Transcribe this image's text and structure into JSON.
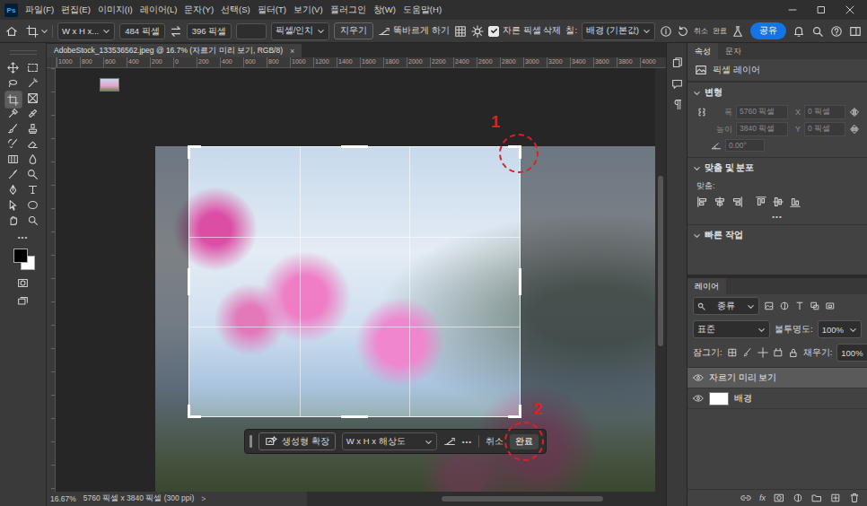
{
  "app": {
    "logo": "Ps"
  },
  "menu": [
    "파일(F)",
    "편집(E)",
    "이미지(I)",
    "레이어(L)",
    "문자(Y)",
    "선택(S)",
    "필터(T)",
    "보기(V)",
    "플러그인",
    "창(W)",
    "도움말(H)"
  ],
  "options_bar": {
    "preset": "W x H x...",
    "width": "484 픽셀",
    "height": "396 픽셀",
    "resolution": "",
    "unit": "픽셀/인치",
    "clear_button": "지우기",
    "straighten_button": "똑바르게 하기",
    "delete_cropped": {
      "label": "자른 픽셀 삭제",
      "checked": true
    },
    "fill_label": "칠:",
    "fill_value": "배경 (기본값)",
    "cancel": "취소",
    "commit": "완료",
    "share_button": "공유"
  },
  "toolbar": {
    "tools": [
      {
        "selected": false
      },
      {
        "selected": false
      },
      {
        "selected": false
      },
      {
        "selected": false
      },
      {
        "selected": true
      },
      {
        "selected": false
      },
      {
        "selected": false
      },
      {
        "selected": false
      },
      {
        "selected": false
      },
      {
        "selected": false
      },
      {
        "selected": false
      },
      {
        "selected": false
      },
      {
        "selected": false
      },
      {
        "selected": false
      },
      {
        "selected": false
      },
      {
        "selected": false
      },
      {
        "selected": false
      },
      {
        "selected": false
      },
      {
        "selected": false
      },
      {
        "selected": false
      },
      {
        "selected": false
      },
      {
        "selected": false
      }
    ],
    "more": "•••"
  },
  "document": {
    "tab_title": "AdobeStock_133536562.jpeg @ 16.7% (자르기 미리 보기, RGB/8)",
    "tab_close": "×",
    "ruler_ticks": [
      "1000",
      "800",
      "600",
      "400",
      "200",
      "0",
      "200",
      "400",
      "600",
      "800",
      "1000",
      "1200",
      "1400",
      "1600",
      "1800",
      "2000",
      "2200",
      "2400",
      "2600",
      "2800",
      "3000",
      "3200",
      "3400",
      "3600",
      "3800",
      "4000"
    ]
  },
  "annotations": [
    {
      "label": "1"
    },
    {
      "label": "2"
    }
  ],
  "crop_bar": {
    "generative_expand": "생성형 확장",
    "preset": "W x H x 해상도",
    "more": "•••",
    "cancel": "취소",
    "done": "완료"
  },
  "status_bar": {
    "zoom": "16.67%",
    "info": "5760 픽셀 x 3840 픽셀 (300 ppi)",
    "arrow": ">"
  },
  "properties": {
    "tabs": [
      {
        "label": "속성",
        "selected": true
      },
      {
        "label": "문자",
        "selected": false
      }
    ],
    "layer_kind": "픽셀 레이어",
    "transform": {
      "title": "변형",
      "expanded": true,
      "fields": [
        {
          "label": "폭",
          "value": "5760 픽셀",
          "disabled": true
        },
        {
          "label": "X",
          "value": "0 픽셀",
          "disabled": true
        },
        {
          "label": "높이",
          "value": "3840 픽셀",
          "disabled": true
        },
        {
          "label": "Y",
          "value": "0 픽셀",
          "disabled": true
        }
      ],
      "angle": {
        "value": "0.00°",
        "disabled": true
      }
    },
    "align": {
      "title": "맞춤 및 분포",
      "expanded": true,
      "label": "맞춤:",
      "more": "•••"
    },
    "quick_actions": {
      "title": "빠른 작업",
      "expanded": true
    }
  },
  "layers_panel": {
    "tabs": [
      {
        "label": "레이어",
        "selected": true
      }
    ],
    "filter": "종류",
    "blend_mode": "표준",
    "opacity_label": "불투명도:",
    "opacity": "100%",
    "lock_label": "잠그기:",
    "fill_label": "채우기:",
    "fill": "100%",
    "layers": [
      {
        "name": "자르기 미리 보기",
        "visible": true,
        "selected": true,
        "kind": "photo"
      },
      {
        "name": "배경",
        "visible": true,
        "selected": false,
        "kind": "fill"
      }
    ],
    "footer_fx": "fx"
  }
}
